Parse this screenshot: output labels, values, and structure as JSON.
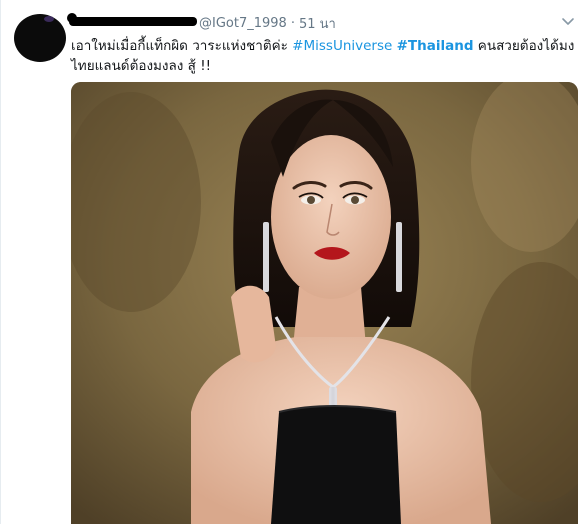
{
  "tweet": {
    "display_name": "",
    "handle": "@IGot7_1998",
    "separator": "·",
    "time": "51 นา",
    "text_before": "เอาใหม่เมื่อกี้แท็กผิด วาระแห่งชาติค่ะ ",
    "hashtag1": "#MissUniverse",
    "space": " ",
    "hashtag2": "#Thailand",
    "text_after": " คนสวยต้องได้มง ไทยแลนด์ต้องมงลง สู้ !!"
  },
  "icons": {
    "caret": "chevron-down-icon"
  },
  "colors": {
    "hashtag": "#1b95e0",
    "muted": "#657786",
    "text": "#14171a",
    "photo_background": "#7a6740",
    "dress": "#0f0f10"
  }
}
